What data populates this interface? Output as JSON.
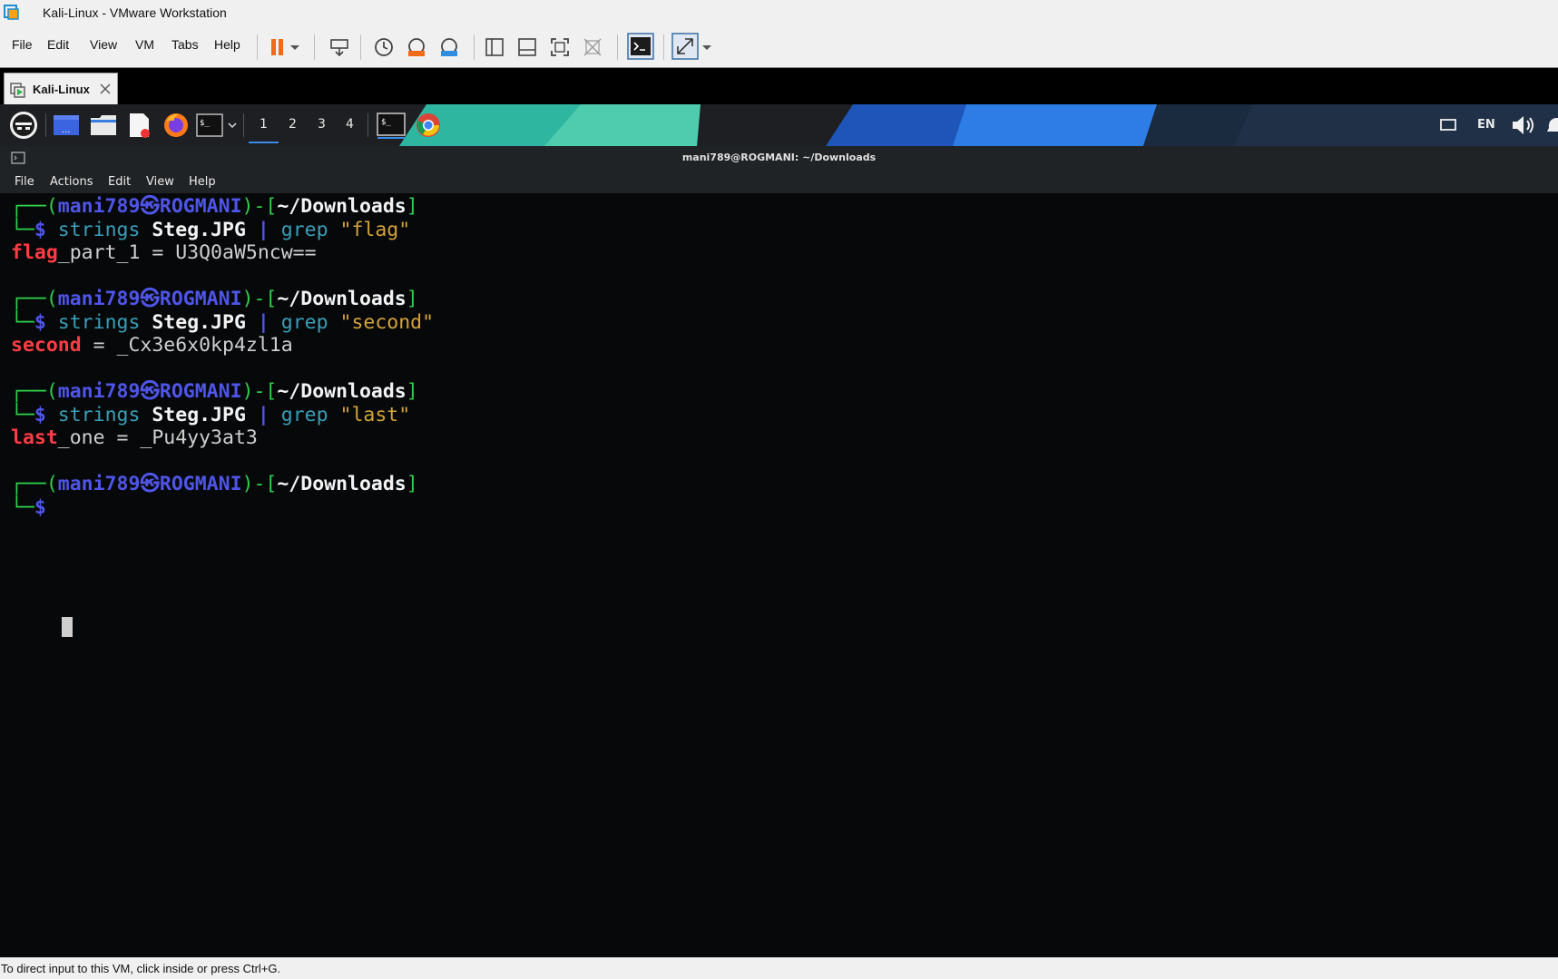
{
  "window": {
    "title": "Kali-Linux - VMware Workstation"
  },
  "vm_menu": [
    "File",
    "Edit",
    "View",
    "VM",
    "Tabs",
    "Help"
  ],
  "vm_tab": {
    "label": "Kali-Linux"
  },
  "panel": {
    "workspaces": [
      "1",
      "2",
      "3",
      "4"
    ],
    "launcher_badge": "...",
    "terminal_glyph": "$_",
    "tray_language": "EN"
  },
  "terminal": {
    "title": "mani789@ROGMANI: ~/Downloads",
    "menu": [
      "File",
      "Actions",
      "Edit",
      "View",
      "Help"
    ],
    "prompt": {
      "corner_top": "┌──(",
      "user": "mani789",
      "at_symbol": "㉿",
      "host": "ROGMANI",
      "mid": ")-[",
      "path": "~/Downloads",
      "end": "]",
      "corner_bottom": "└─",
      "dollar": "$"
    },
    "commands": [
      {
        "cmd": "strings",
        "file": "Steg.JPG",
        "pipe": "|",
        "grep": "grep",
        "pattern": "\"flag\"",
        "out_highlight": "flag",
        "out_rest": "_part_1 = U3Q0aW5ncw=="
      },
      {
        "cmd": "strings",
        "file": "Steg.JPG",
        "pipe": "|",
        "grep": "grep",
        "pattern": "\"second\"",
        "out_highlight": "second",
        "out_rest": " = _Cx3e6x0kp4zl1a"
      },
      {
        "cmd": "strings",
        "file": "Steg.JPG",
        "pipe": "|",
        "grep": "grep",
        "pattern": "\"last\"",
        "out_highlight": "last",
        "out_rest": "_one = _Pu4yy3at3"
      }
    ]
  },
  "statusbar": {
    "text": "To direct input to this VM, click inside or press Ctrl+G."
  },
  "colors": {
    "prompt_green": "#2fd14b",
    "prompt_blue": "#4f55e8",
    "grep_match_red": "#ff3c44",
    "string_yellow": "#d4a43a",
    "pause_orange": "#f06a1a"
  }
}
